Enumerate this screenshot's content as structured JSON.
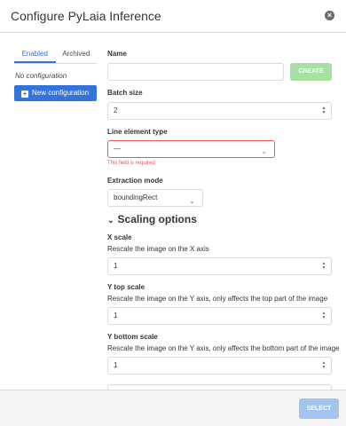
{
  "dialog": {
    "title": "Configure PyLaia Inference",
    "close_icon": "close-icon"
  },
  "sidebar": {
    "tabs": [
      {
        "label": "Enabled",
        "active": true
      },
      {
        "label": "Archived",
        "active": false
      }
    ],
    "empty_text": "No configuration",
    "new_button": "New configuration"
  },
  "form": {
    "name": {
      "label": "Name",
      "value": "",
      "create_button": "CREATE"
    },
    "batch_size": {
      "label": "Batch size",
      "value": "2"
    },
    "line_element_type": {
      "label": "Line element type",
      "value": "—",
      "error": "This field is required"
    },
    "extraction_mode": {
      "label": "Extraction mode",
      "value": "boundingRect"
    },
    "scaling_section": "Scaling options",
    "x_scale": {
      "label": "X scale",
      "help": "Rescale the image on the X axis",
      "value": "1"
    },
    "y_top_scale": {
      "label": "Y top scale",
      "help": "Rescale the image on the Y axis, only affects the top part of the image",
      "value": "1"
    },
    "y_bottom_scale": {
      "label": "Y bottom scale",
      "help": "Rescale the image on the Y axis, only affects the bottom part of the image",
      "value": "1"
    }
  },
  "footer": {
    "select_button": "SELECT"
  },
  "colors": {
    "primary": "#3273dc",
    "success_light": "#a8dfa2",
    "danger": "#e5585c",
    "primary_light": "#a3c4ec"
  }
}
